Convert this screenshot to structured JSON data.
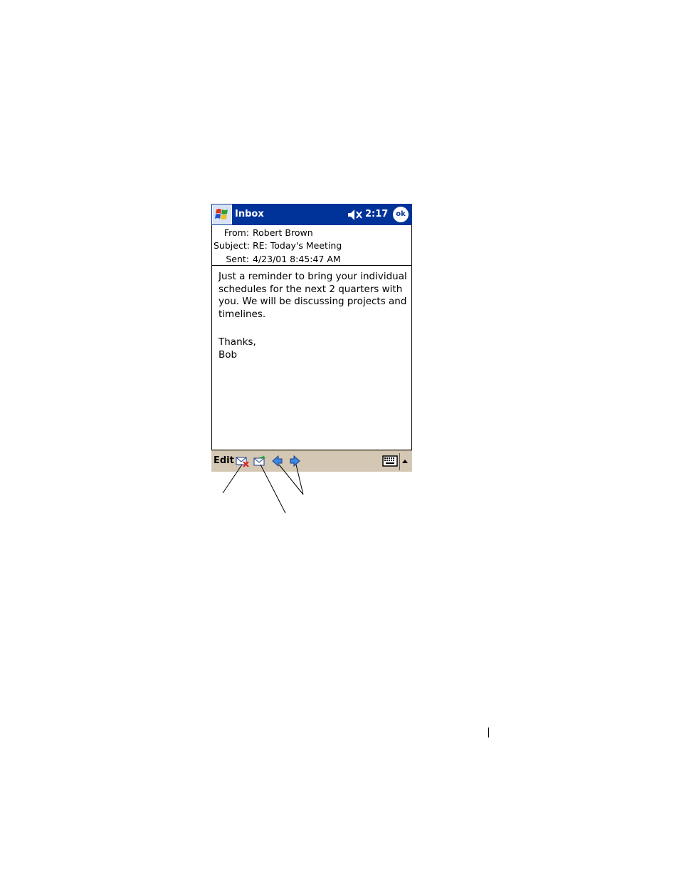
{
  "titlebar": {
    "app_title": "Inbox",
    "clock": "2:17",
    "ok_label": "ok",
    "start_icon": "windows-flag-icon",
    "volume_icon": "speaker-muted-icon",
    "bg_color": "#003399"
  },
  "message": {
    "from_label": "From:",
    "from_value": "Robert Brown",
    "subject_label": "Subject:",
    "subject_value": "RE: Today's Meeting",
    "sent_label": "Sent:",
    "sent_value": "4/23/01 8:45:47 AM",
    "body_paragraph": "Just a reminder to bring your individual schedules for the next 2 quarters with you. We will be discussing projects and timelines.",
    "closing": "Thanks,",
    "signature": "Bob"
  },
  "command_bar": {
    "edit_label": "Edit",
    "icons": [
      "delete-message-icon",
      "reply-message-icon",
      "previous-arrow-icon",
      "next-arrow-icon",
      "keyboard-icon",
      "sip-up-arrow-icon"
    ],
    "bg_color": "#d4c8b4"
  }
}
